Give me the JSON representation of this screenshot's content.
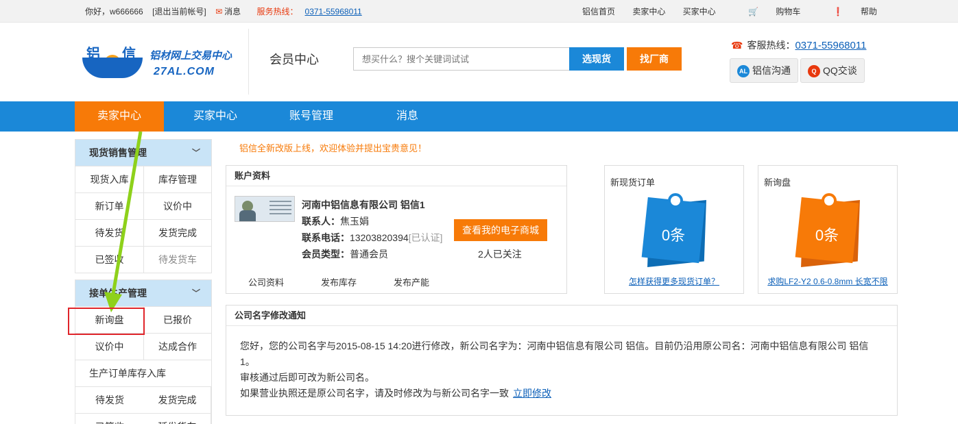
{
  "topbar": {
    "greeting": "你好，w666666",
    "logout": "[退出当前帐号]",
    "messages": "消息",
    "service_label": "服务热线：",
    "service_phone": "0371-55968011",
    "links": {
      "home": "铝信首页",
      "seller": "卖家中心",
      "buyer": "买家中心",
      "cart": "购物车",
      "help": "帮助"
    }
  },
  "header": {
    "logo_char1": "铝",
    "logo_char2": "信",
    "logo_title": "铝材网上交易中心",
    "logo_domain": "27AL.COM",
    "member_center": "会员中心",
    "search_placeholder": "想买什么？搜个关键词试试",
    "search_spot_btn": "选现货",
    "search_factory_btn": "找厂商",
    "hotline_label": "客服热线：",
    "hotline_phone": "0371-55968011",
    "chat_lvxin": "铝信沟通",
    "chat_qq": "QQ交谈",
    "al_badge": "AL"
  },
  "nav": {
    "items": [
      "卖家中心",
      "买家中心",
      "账号管理",
      "消息"
    ]
  },
  "sidebar": {
    "spot": {
      "title": "现货销售管理",
      "items": [
        "现货入库",
        "库存管理",
        "新订单",
        "议价中",
        "待发货",
        "发货完成",
        "已签收",
        "待发货车"
      ]
    },
    "production": {
      "title": "接单生产管理",
      "items": [
        "新询盘",
        "已报价",
        "议价中",
        "达成合作"
      ],
      "full_item": "生产订单库存入库",
      "items2": [
        "待发货",
        "发货完成",
        "已签收",
        "延发货车"
      ]
    }
  },
  "notice_banner": "铝信全新改版上线，欢迎体验并提出宝贵意见！",
  "account": {
    "title": "账户资料",
    "company": "河南中铝信息有限公司 铝信1",
    "contact_label": "联系人：",
    "contact": "焦玉娟",
    "phone_label": "联系电话：",
    "phone": "13203820394",
    "verified": "[已认证]",
    "member_type_label": "会员类型：",
    "member_type": "普通会员",
    "shop_btn": "查看我的电子商城",
    "followers": "2人已关注",
    "links": [
      "公司资料",
      "发布库存",
      "发布产能"
    ]
  },
  "spot_orders": {
    "title": "新现货订单",
    "count": "0条",
    "link": "怎样获得更多现货订单？",
    "color": "#1b88d8"
  },
  "inquiries": {
    "title": "新询盘",
    "count": "0条",
    "link": "求购LF2-Y2 0.6-0.8mm 长宽不限",
    "color": "#f77a08"
  },
  "rename_notice": {
    "title": "公司名字修改通知",
    "line1": "您好，您的公司名字与2015-08-15 14:20进行修改，新公司名字为：河南中铝信息有限公司 铝信。目前仍沿用原公司名：河南中铝信息有限公司 铝信1。",
    "line2": "审核通过后即可改为新公司名。",
    "line3": "如果营业执照还是原公司名字，请及时修改为与新公司名字一致",
    "action": "立即修改"
  }
}
